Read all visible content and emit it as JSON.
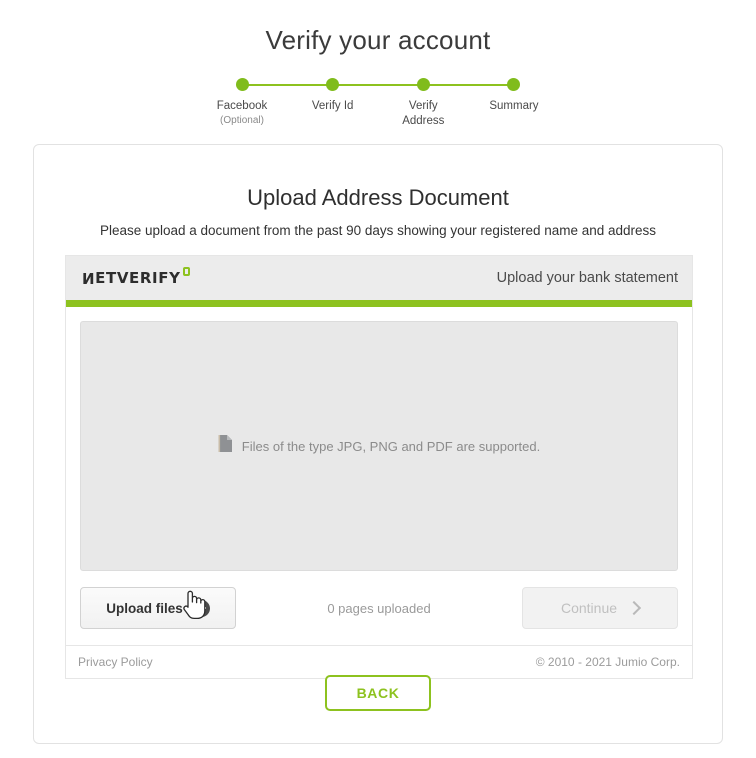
{
  "header": {
    "title": "Verify your account"
  },
  "stepper": {
    "steps": [
      {
        "label": "Facebook",
        "sub": "(Optional)",
        "state": "complete"
      },
      {
        "label": "Verify Id",
        "sub": "",
        "state": "complete"
      },
      {
        "label": "Verify\nAddress",
        "sub": "",
        "state": "active"
      },
      {
        "label": "Summary",
        "sub": "",
        "state": "complete"
      }
    ],
    "dot_color": "#80bc1c",
    "line_color": "#8dc21f"
  },
  "card": {
    "title": "Upload Address Document",
    "subtitle": "Please upload a document from the past 90 days showing your registered name and address"
  },
  "widget": {
    "logo_first_letter": "N",
    "logo_text": "ETVERIFY",
    "logo_mark": "square-mark-icon",
    "head_right": "Upload your bank statement",
    "accent_color": "#8dc21f",
    "dropzone": {
      "icon": "document-icon",
      "text": "Files of the type JPG, PNG and PDF are supported."
    },
    "actions": {
      "upload_label": "Upload files",
      "upload_icon": "plus-circle-icon",
      "pages_status": "0 pages uploaded",
      "continue_label": "Continue",
      "continue_icon": "chevron-right-icon",
      "continue_disabled": true
    },
    "footer": {
      "privacy": "Privacy Policy",
      "copyright": "© 2010 - 2021 Jumio Corp."
    }
  },
  "back": {
    "label": "BACK",
    "color": "#8dc21f"
  },
  "cursor": {
    "type": "pointer-hand-cursor"
  }
}
